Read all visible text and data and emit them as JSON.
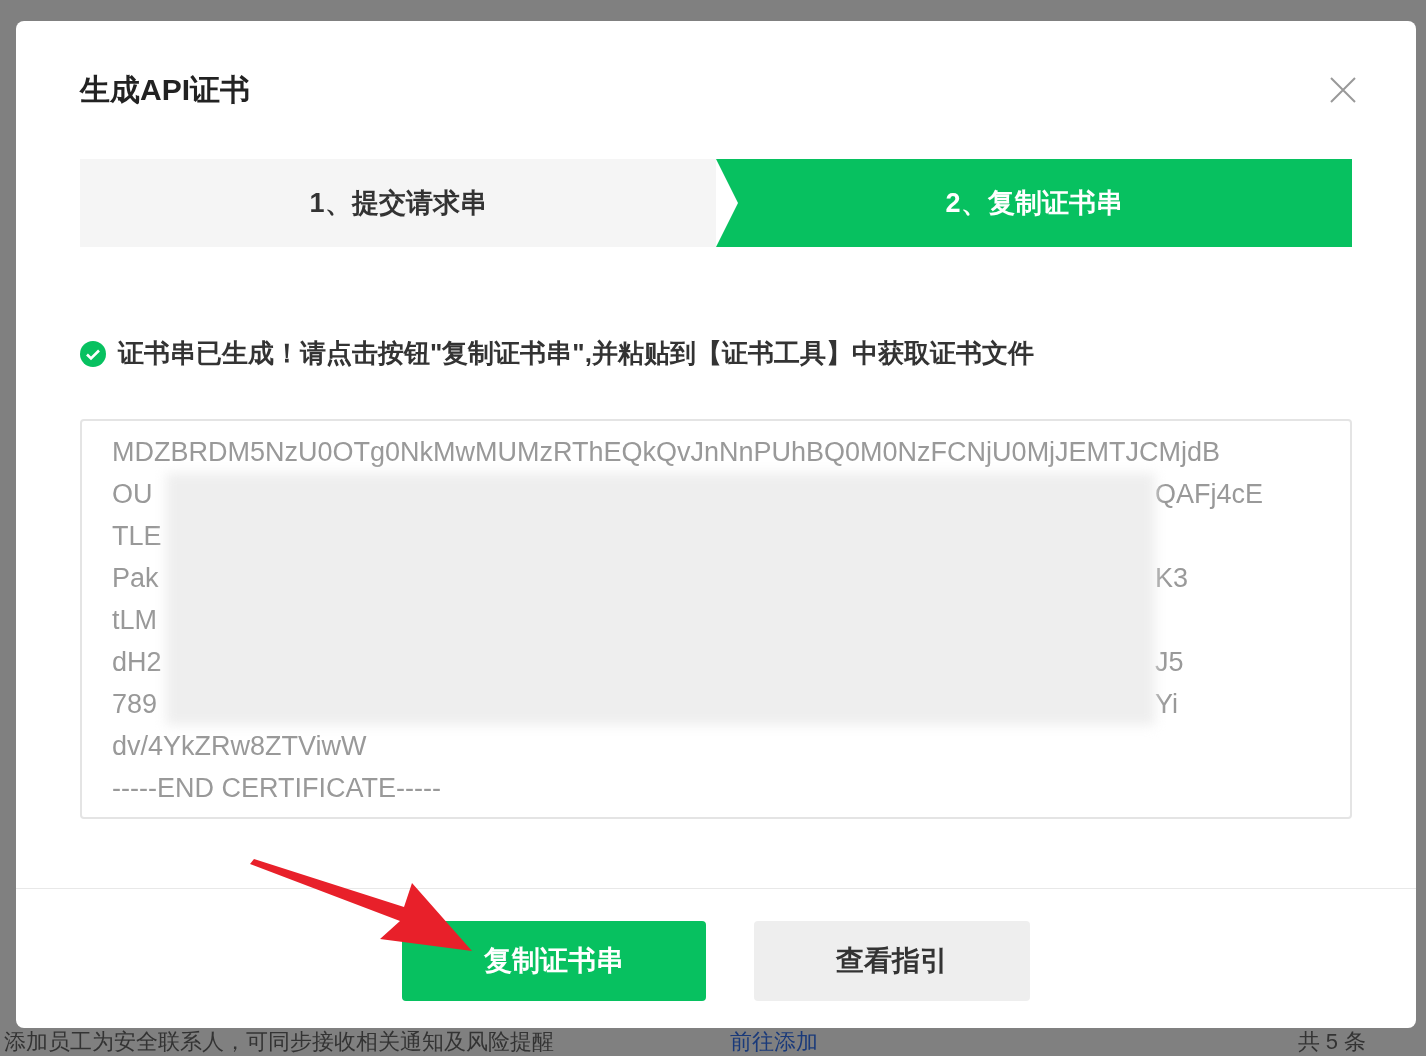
{
  "dialog": {
    "title": "生成API证书",
    "steps": [
      {
        "label": "1、提交请求串",
        "selected": false
      },
      {
        "label": "2、复制证书串",
        "selected": true
      }
    ],
    "message": "证书串已生成！请点击按钮\"复制证书串\",并粘贴到【证书工具】中获取证书文件",
    "certificate_lines": [
      {
        "kind": "full",
        "text": "MDZBRDM5NzU0OTg0NkMwMUMzRThEQkQvJnNnPUhBQ0M0NzFCNjU0MjJEMTJCMjdB"
      },
      {
        "kind": "masked",
        "start": "OU",
        "end": "QAFj4cE"
      },
      {
        "kind": "masked",
        "start": "TLE"
      },
      {
        "kind": "masked",
        "start": "Pak",
        "end": "K3"
      },
      {
        "kind": "masked",
        "start": "tLM"
      },
      {
        "kind": "masked",
        "start": "dH2",
        "end": "J5"
      },
      {
        "kind": "masked",
        "start": "789",
        "end": "Yi"
      },
      {
        "kind": "full",
        "text": "dv/4YkZRw8ZTViwW"
      },
      {
        "kind": "full",
        "text": "-----END CERTIFICATE-----"
      }
    ],
    "buttons": [
      {
        "label": "复制证书串",
        "kind": "primary"
      },
      {
        "label": "查看指引",
        "kind": "secondary"
      }
    ]
  },
  "background": {
    "notice": "添加员工为安全联系人，可同步接收相关通知及风险提醒",
    "link": "前往添加",
    "count": "共 5 条"
  }
}
